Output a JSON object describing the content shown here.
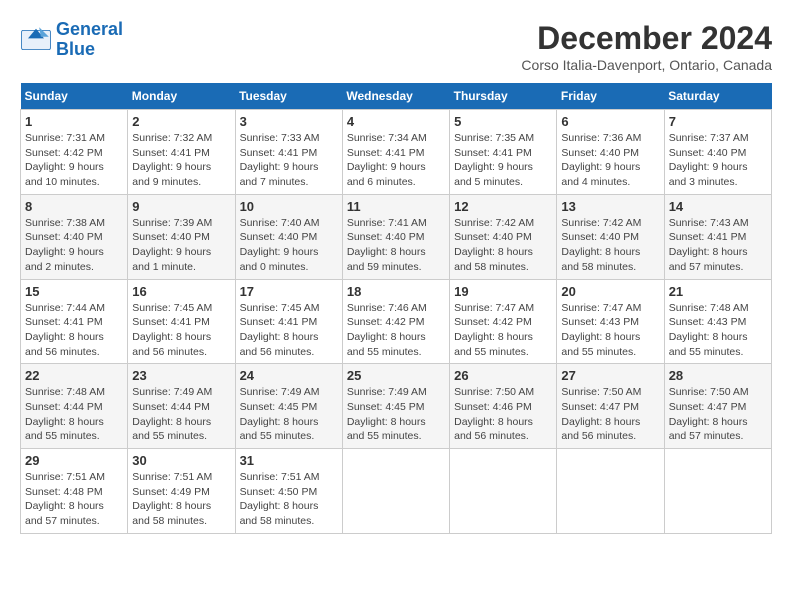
{
  "logo": {
    "line1": "General",
    "line2": "Blue"
  },
  "title": "December 2024",
  "subtitle": "Corso Italia-Davenport, Ontario, Canada",
  "days_of_week": [
    "Sunday",
    "Monday",
    "Tuesday",
    "Wednesday",
    "Thursday",
    "Friday",
    "Saturday"
  ],
  "weeks": [
    [
      {
        "day": "1",
        "sunrise": "Sunrise: 7:31 AM",
        "sunset": "Sunset: 4:42 PM",
        "daylight": "Daylight: 9 hours and 10 minutes."
      },
      {
        "day": "2",
        "sunrise": "Sunrise: 7:32 AM",
        "sunset": "Sunset: 4:41 PM",
        "daylight": "Daylight: 9 hours and 9 minutes."
      },
      {
        "day": "3",
        "sunrise": "Sunrise: 7:33 AM",
        "sunset": "Sunset: 4:41 PM",
        "daylight": "Daylight: 9 hours and 7 minutes."
      },
      {
        "day": "4",
        "sunrise": "Sunrise: 7:34 AM",
        "sunset": "Sunset: 4:41 PM",
        "daylight": "Daylight: 9 hours and 6 minutes."
      },
      {
        "day": "5",
        "sunrise": "Sunrise: 7:35 AM",
        "sunset": "Sunset: 4:41 PM",
        "daylight": "Daylight: 9 hours and 5 minutes."
      },
      {
        "day": "6",
        "sunrise": "Sunrise: 7:36 AM",
        "sunset": "Sunset: 4:40 PM",
        "daylight": "Daylight: 9 hours and 4 minutes."
      },
      {
        "day": "7",
        "sunrise": "Sunrise: 7:37 AM",
        "sunset": "Sunset: 4:40 PM",
        "daylight": "Daylight: 9 hours and 3 minutes."
      }
    ],
    [
      {
        "day": "8",
        "sunrise": "Sunrise: 7:38 AM",
        "sunset": "Sunset: 4:40 PM",
        "daylight": "Daylight: 9 hours and 2 minutes."
      },
      {
        "day": "9",
        "sunrise": "Sunrise: 7:39 AM",
        "sunset": "Sunset: 4:40 PM",
        "daylight": "Daylight: 9 hours and 1 minute."
      },
      {
        "day": "10",
        "sunrise": "Sunrise: 7:40 AM",
        "sunset": "Sunset: 4:40 PM",
        "daylight": "Daylight: 9 hours and 0 minutes."
      },
      {
        "day": "11",
        "sunrise": "Sunrise: 7:41 AM",
        "sunset": "Sunset: 4:40 PM",
        "daylight": "Daylight: 8 hours and 59 minutes."
      },
      {
        "day": "12",
        "sunrise": "Sunrise: 7:42 AM",
        "sunset": "Sunset: 4:40 PM",
        "daylight": "Daylight: 8 hours and 58 minutes."
      },
      {
        "day": "13",
        "sunrise": "Sunrise: 7:42 AM",
        "sunset": "Sunset: 4:40 PM",
        "daylight": "Daylight: 8 hours and 58 minutes."
      },
      {
        "day": "14",
        "sunrise": "Sunrise: 7:43 AM",
        "sunset": "Sunset: 4:41 PM",
        "daylight": "Daylight: 8 hours and 57 minutes."
      }
    ],
    [
      {
        "day": "15",
        "sunrise": "Sunrise: 7:44 AM",
        "sunset": "Sunset: 4:41 PM",
        "daylight": "Daylight: 8 hours and 56 minutes."
      },
      {
        "day": "16",
        "sunrise": "Sunrise: 7:45 AM",
        "sunset": "Sunset: 4:41 PM",
        "daylight": "Daylight: 8 hours and 56 minutes."
      },
      {
        "day": "17",
        "sunrise": "Sunrise: 7:45 AM",
        "sunset": "Sunset: 4:41 PM",
        "daylight": "Daylight: 8 hours and 56 minutes."
      },
      {
        "day": "18",
        "sunrise": "Sunrise: 7:46 AM",
        "sunset": "Sunset: 4:42 PM",
        "daylight": "Daylight: 8 hours and 55 minutes."
      },
      {
        "day": "19",
        "sunrise": "Sunrise: 7:47 AM",
        "sunset": "Sunset: 4:42 PM",
        "daylight": "Daylight: 8 hours and 55 minutes."
      },
      {
        "day": "20",
        "sunrise": "Sunrise: 7:47 AM",
        "sunset": "Sunset: 4:43 PM",
        "daylight": "Daylight: 8 hours and 55 minutes."
      },
      {
        "day": "21",
        "sunrise": "Sunrise: 7:48 AM",
        "sunset": "Sunset: 4:43 PM",
        "daylight": "Daylight: 8 hours and 55 minutes."
      }
    ],
    [
      {
        "day": "22",
        "sunrise": "Sunrise: 7:48 AM",
        "sunset": "Sunset: 4:44 PM",
        "daylight": "Daylight: 8 hours and 55 minutes."
      },
      {
        "day": "23",
        "sunrise": "Sunrise: 7:49 AM",
        "sunset": "Sunset: 4:44 PM",
        "daylight": "Daylight: 8 hours and 55 minutes."
      },
      {
        "day": "24",
        "sunrise": "Sunrise: 7:49 AM",
        "sunset": "Sunset: 4:45 PM",
        "daylight": "Daylight: 8 hours and 55 minutes."
      },
      {
        "day": "25",
        "sunrise": "Sunrise: 7:49 AM",
        "sunset": "Sunset: 4:45 PM",
        "daylight": "Daylight: 8 hours and 55 minutes."
      },
      {
        "day": "26",
        "sunrise": "Sunrise: 7:50 AM",
        "sunset": "Sunset: 4:46 PM",
        "daylight": "Daylight: 8 hours and 56 minutes."
      },
      {
        "day": "27",
        "sunrise": "Sunrise: 7:50 AM",
        "sunset": "Sunset: 4:47 PM",
        "daylight": "Daylight: 8 hours and 56 minutes."
      },
      {
        "day": "28",
        "sunrise": "Sunrise: 7:50 AM",
        "sunset": "Sunset: 4:47 PM",
        "daylight": "Daylight: 8 hours and 57 minutes."
      }
    ],
    [
      {
        "day": "29",
        "sunrise": "Sunrise: 7:51 AM",
        "sunset": "Sunset: 4:48 PM",
        "daylight": "Daylight: 8 hours and 57 minutes."
      },
      {
        "day": "30",
        "sunrise": "Sunrise: 7:51 AM",
        "sunset": "Sunset: 4:49 PM",
        "daylight": "Daylight: 8 hours and 58 minutes."
      },
      {
        "day": "31",
        "sunrise": "Sunrise: 7:51 AM",
        "sunset": "Sunset: 4:50 PM",
        "daylight": "Daylight: 8 hours and 58 minutes."
      },
      null,
      null,
      null,
      null
    ]
  ]
}
